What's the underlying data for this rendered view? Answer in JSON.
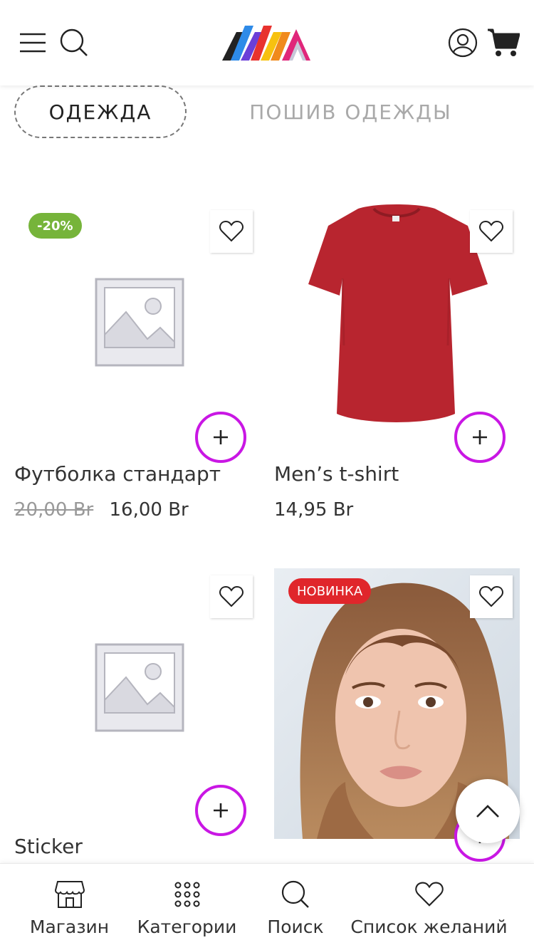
{
  "header": {
    "menu_icon": "menu-icon",
    "search_icon": "search-icon",
    "account_icon": "account-icon",
    "cart_icon": "cart-icon"
  },
  "tabs": [
    {
      "label": "ОДЕЖДА",
      "active": true
    },
    {
      "label": "ПОШИВ ОДЕЖДЫ",
      "active": false
    }
  ],
  "products": [
    {
      "title": "Футболка стандарт",
      "old_price": "20,00 Br",
      "price": "16,00 Br",
      "badge": "-20%",
      "image": "placeholder"
    },
    {
      "title": "Men’s t-shirt",
      "price": "14,95 Br",
      "image": "red t-shirt"
    },
    {
      "title": "Sticker",
      "image": "placeholder"
    },
    {
      "badge": "НОВИНКА",
      "image": "woman portrait"
    }
  ],
  "bottom_nav": [
    {
      "label": "Магазин",
      "icon": "shop-icon"
    },
    {
      "label": "Категории",
      "icon": "grid-icon"
    },
    {
      "label": "Поиск",
      "icon": "search-icon"
    },
    {
      "label": "Список желаний",
      "icon": "heart-icon"
    }
  ],
  "colors": {
    "accent": "#c917e4",
    "sale_badge": "#76b43a",
    "new_badge": "#e0262b"
  }
}
